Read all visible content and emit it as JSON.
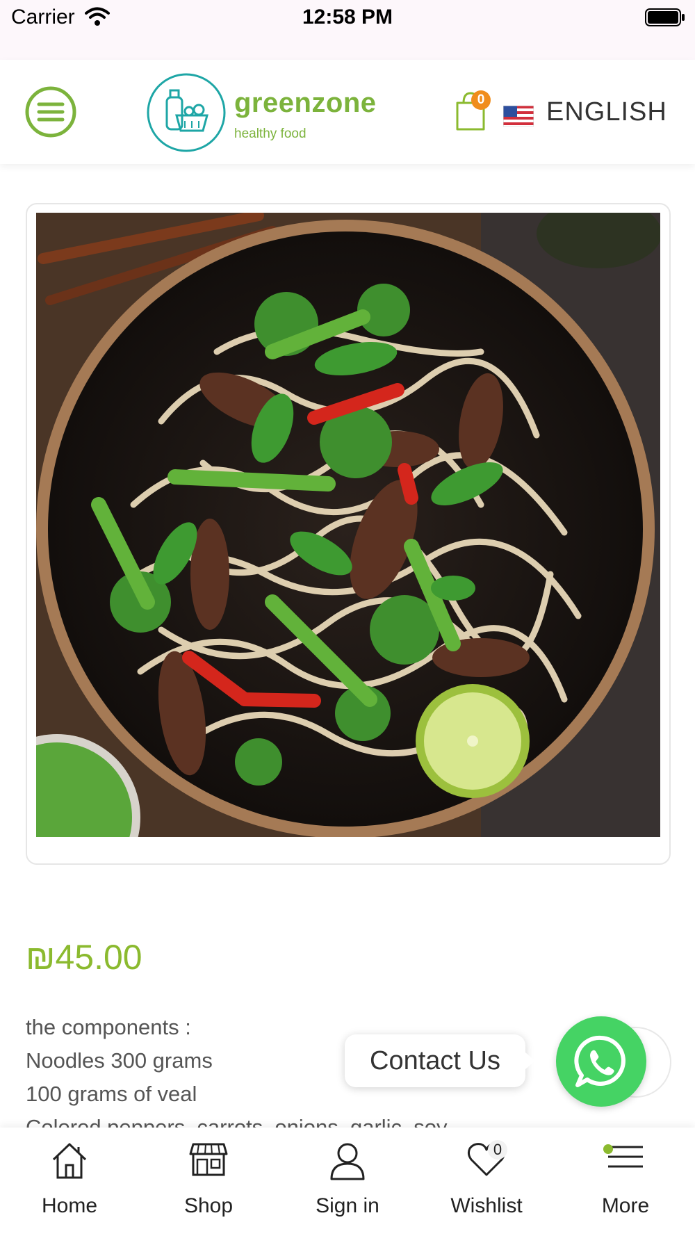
{
  "status_bar": {
    "carrier": "Carrier",
    "time": "12:58 PM"
  },
  "header": {
    "brand_name": "greenzone",
    "brand_tagline": "healthy food",
    "cart_count": "0",
    "language": "ENGLISH",
    "icons": {
      "menu": "hamburger-icon",
      "cart": "shopping-bag-icon",
      "flag": "us-flag-icon"
    }
  },
  "product": {
    "image": "noodles-with-beef-and-vegetables",
    "price": "₪45.00",
    "description_lines": [
      "the components :",
      "Noodles 300 grams",
      "100 grams of veal",
      "Colored peppers, carrots, onions, garlic, soy"
    ]
  },
  "contact": {
    "label": "Contact Us",
    "icon": "whatsapp-icon"
  },
  "bottom_nav": [
    {
      "label": "Home",
      "icon": "home-icon"
    },
    {
      "label": "Shop",
      "icon": "shop-icon"
    },
    {
      "label": "Sign in",
      "icon": "user-icon"
    },
    {
      "label": "Wishlist",
      "icon": "heart-icon",
      "badge": "0"
    },
    {
      "label": "More",
      "icon": "menu-lines-icon"
    }
  ],
  "colors": {
    "brand_green": "#7cb33c",
    "price_green": "#8bba2f",
    "whatsapp": "#45d364",
    "cart_badge": "#f08d1c",
    "logo_teal": "#1ea6a6"
  }
}
